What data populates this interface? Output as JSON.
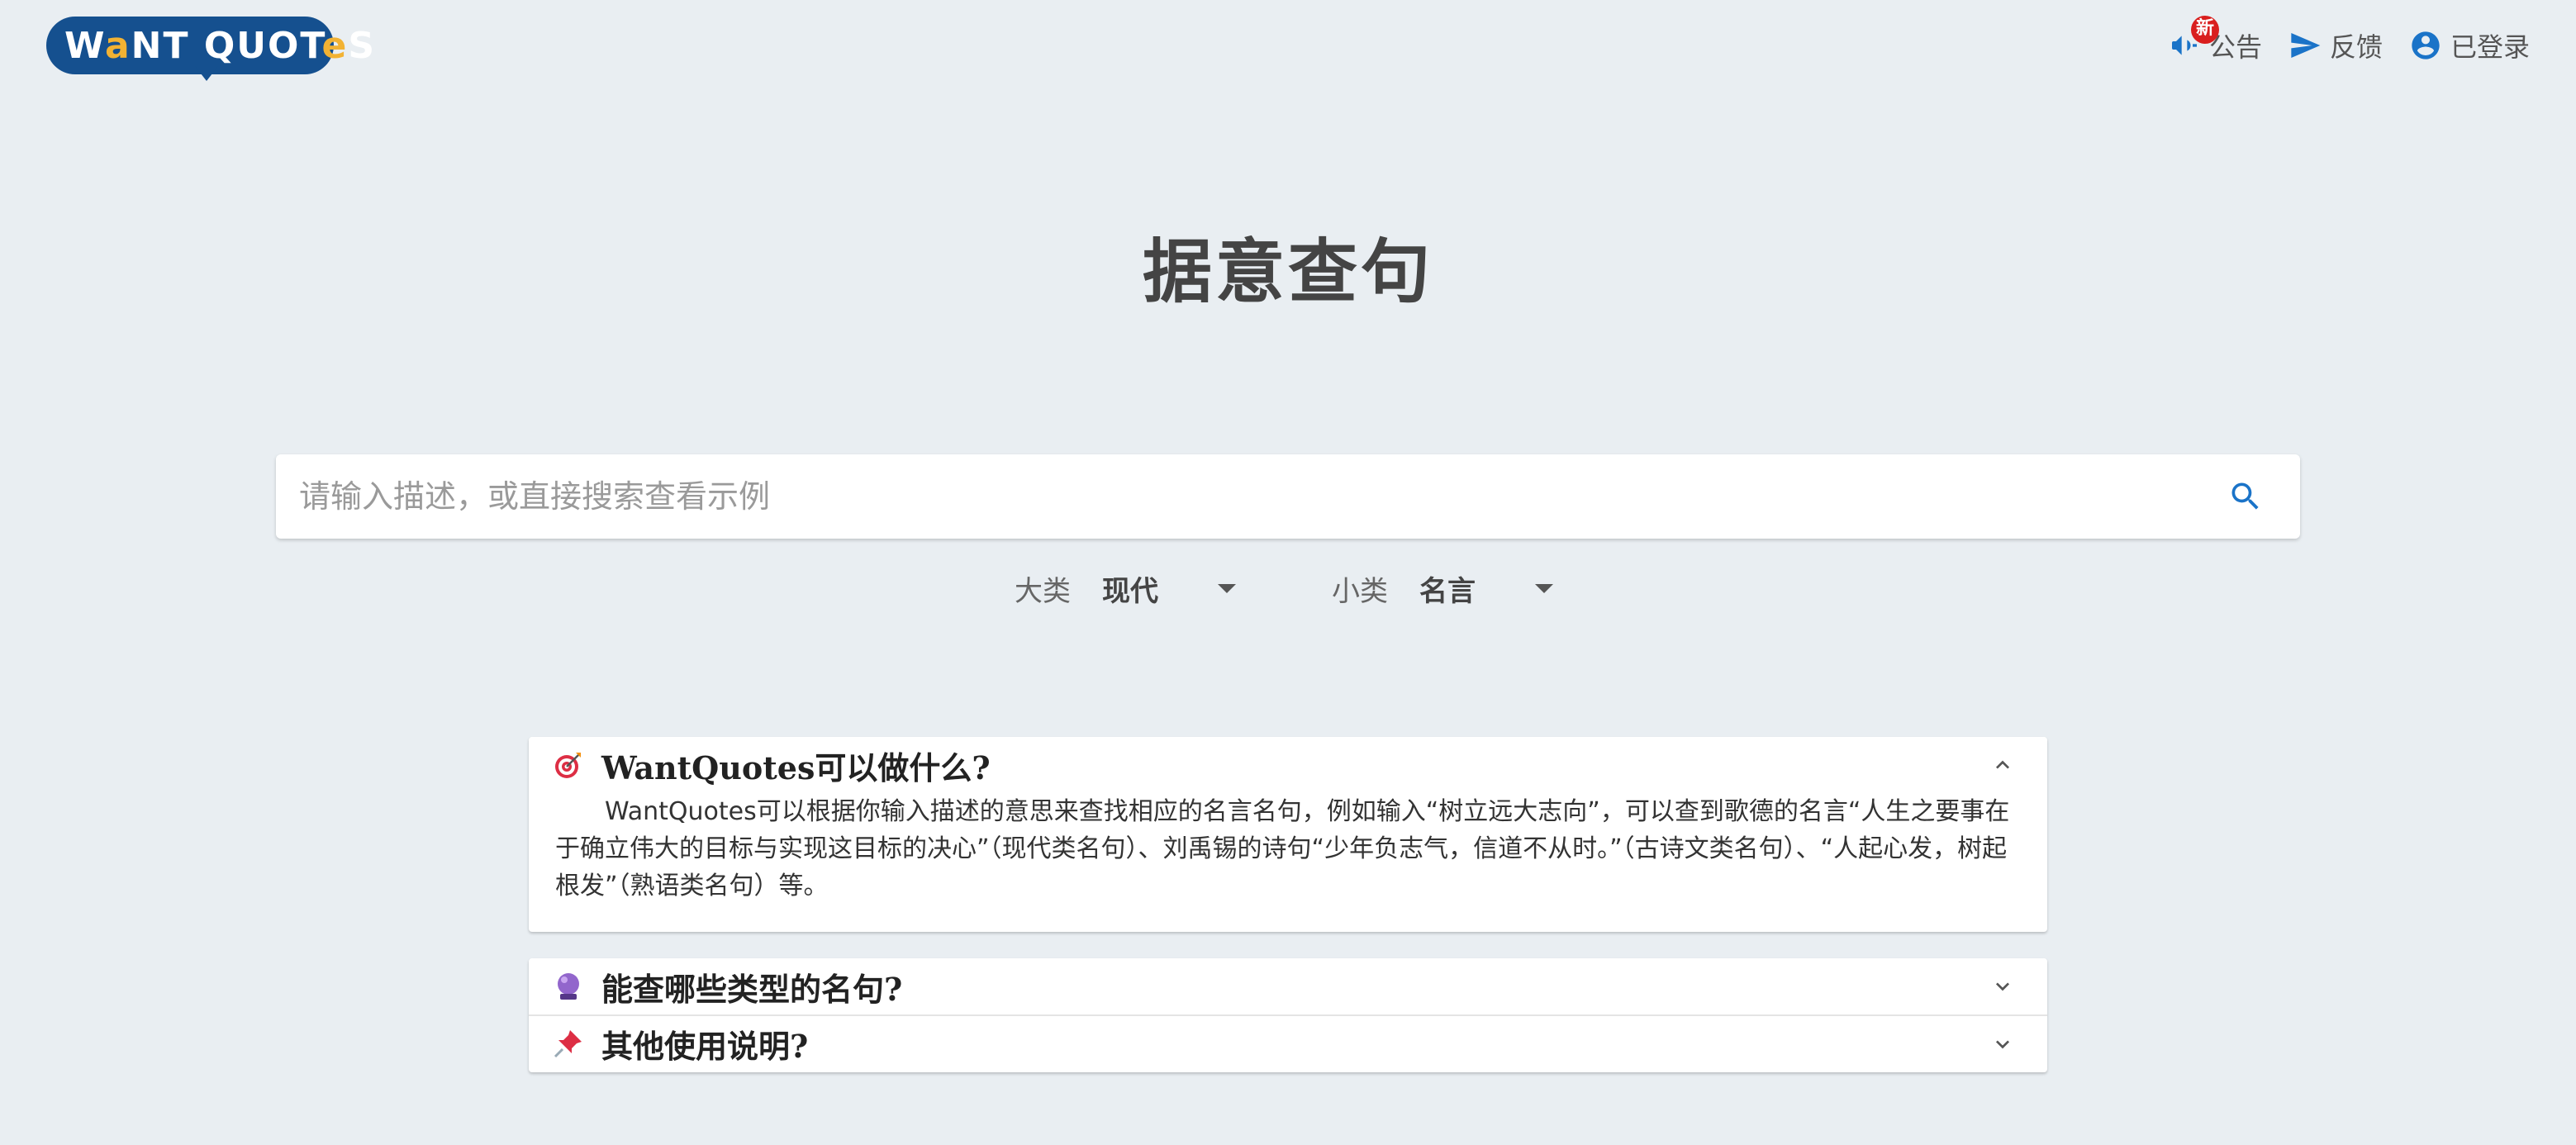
{
  "header": {
    "logo_text_1": "W",
    "logo_text_accent_1": "a",
    "logo_text_2": "NT QUOT",
    "logo_text_accent_2": "e",
    "logo_text_3": "S",
    "nav": {
      "announce_badge": "新",
      "announce_label": "公告",
      "feedback_label": "反馈",
      "account_label": "已登录"
    }
  },
  "page_title": "据意查句",
  "search": {
    "placeholder": "请输入描述，或直接搜索查看示例"
  },
  "filters": {
    "category_label": "大类",
    "category_value": "现代",
    "subcategory_label": "小类",
    "subcategory_value": "名言"
  },
  "faq": [
    {
      "emoji": "dart-icon",
      "title": "WantQuotes可以做什么?",
      "expanded": true,
      "body": "WantQuotes可以根据你输入描述的意思来查找相应的名言名句，例如输入“树立远大志向”，可以查到歌德的名言“人生之要事在于确立伟大的目标与实现这目标的决心”（现代类名句）、刘禹锡的诗句“少年负志气，信道不从时。”（古诗文类名句）、“人起心发，树起根发”（熟语类名句）等。"
    },
    {
      "emoji": "crystal-ball-icon",
      "title": "能查哪些类型的名句?",
      "expanded": false
    },
    {
      "emoji": "pushpin-icon",
      "title": "其他使用说明?",
      "expanded": false
    }
  ],
  "colors": {
    "background": "#e9eef2",
    "brand": "#15508f",
    "brand_accent": "#f2b233",
    "icon_blue": "#1a73c8",
    "badge_red": "#d91e1e"
  }
}
